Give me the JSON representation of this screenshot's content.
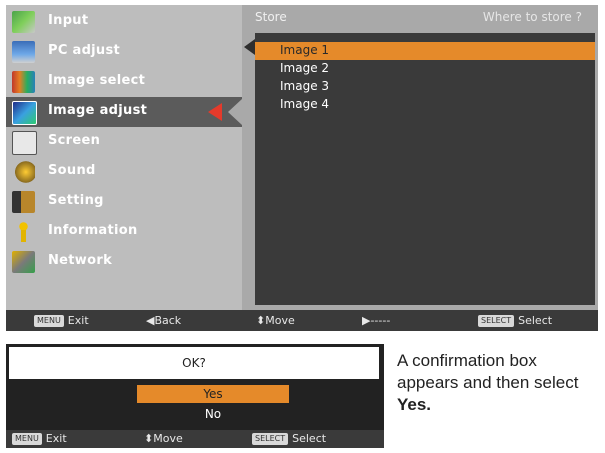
{
  "menu": {
    "items": [
      {
        "label": "Input",
        "icon": "input-icon"
      },
      {
        "label": "PC adjust",
        "icon": "pc-adjust-icon"
      },
      {
        "label": "Image select",
        "icon": "image-select-icon"
      },
      {
        "label": "Image adjust",
        "icon": "image-adjust-icon"
      },
      {
        "label": "Screen",
        "icon": "screen-icon"
      },
      {
        "label": "Sound",
        "icon": "sound-icon"
      },
      {
        "label": "Setting",
        "icon": "setting-icon"
      },
      {
        "label": "Information",
        "icon": "information-icon"
      },
      {
        "label": "Network",
        "icon": "network-icon"
      }
    ],
    "active_index": 3
  },
  "store_panel": {
    "title": "Store",
    "hint": "Where to store ?",
    "items": [
      "Image 1",
      "Image 2",
      "Image 3",
      "Image 4"
    ],
    "selected_index": 0
  },
  "bottom_bar": {
    "exit_key": "MENU",
    "exit_label": "Exit",
    "back_label": "◀Back",
    "move_label": "⬍Move",
    "right_label": "▶-----",
    "select_key": "SELECT",
    "select_label": "Select"
  },
  "confirm": {
    "question": "OK?",
    "yes": "Yes",
    "no": "No",
    "bar": {
      "exit_key": "MENU",
      "exit_label": "Exit",
      "move_label": "⬍Move",
      "select_key": "SELECT",
      "select_label": "Select"
    }
  },
  "caption": {
    "text": "A confirmation box appears and then select",
    "bold": "Yes."
  },
  "colors": {
    "highlight": "#e58a2a",
    "active_arrow": "#e53a2b",
    "panel_dark": "#3a3a3a"
  }
}
